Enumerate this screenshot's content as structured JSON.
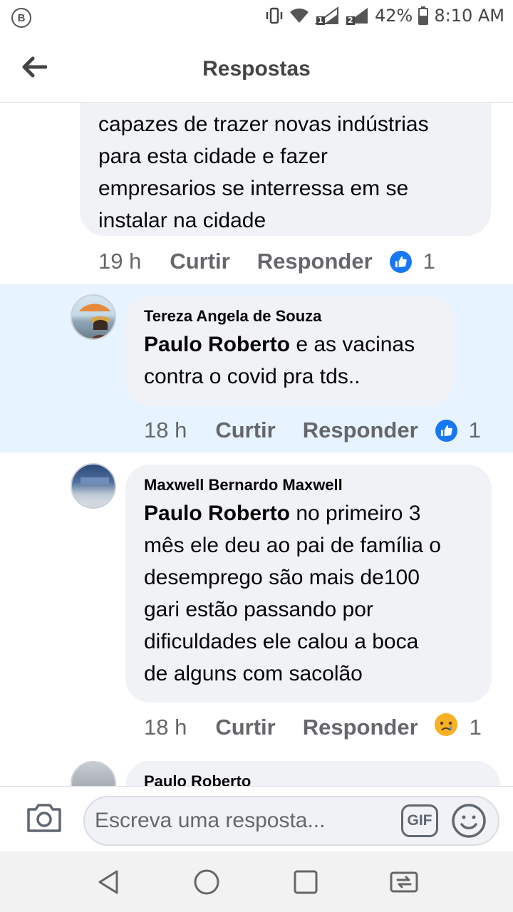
{
  "status": {
    "battery": "42%",
    "time": "8:10 AM",
    "sim1": "1",
    "sim2": "2",
    "app_badge": "B"
  },
  "header": {
    "title": "Respostas"
  },
  "comments": [
    {
      "lines": [
        "capazes de trazer novas indústrias",
        "para esta cidade e fazer",
        "empresarios se interressa em se",
        "instalar na cidade"
      ],
      "time": "19 h",
      "like_label": "Curtir",
      "reply_label": "Responder",
      "reaction": "like-icon",
      "reaction_count": "1"
    },
    {
      "author": "Tereza Angela de Souza",
      "mention": "Paulo Roberto",
      "line1_rest": " e as vacinas",
      "line2": "contra o covid pra tds..",
      "time": "18 h",
      "like_label": "Curtir",
      "reply_label": "Responder",
      "reaction": "like-icon",
      "reaction_count": "1"
    },
    {
      "author": "Maxwell Bernardo Maxwell",
      "mention": "Paulo Roberto",
      "line1_rest": " no primeiro 3",
      "lines": [
        "mês ele deu ao pai de família o",
        "desemprego são mais de100",
        "gari estão passando por",
        "dificuldades ele calou a boca",
        "de alguns com sacolão"
      ],
      "time": "18 h",
      "like_label": "Curtir",
      "reply_label": "Responder",
      "reaction": "sad-icon",
      "reaction_count": "1"
    },
    {
      "author": "Paulo Roberto"
    }
  ],
  "composer": {
    "placeholder": "Escreva uma resposta...",
    "gif_label": "GIF"
  },
  "colors": {
    "accent": "#1877f2",
    "highlight": "#e7f3ff",
    "bubble": "#f0f2f5",
    "muted_text": "#65676b"
  }
}
